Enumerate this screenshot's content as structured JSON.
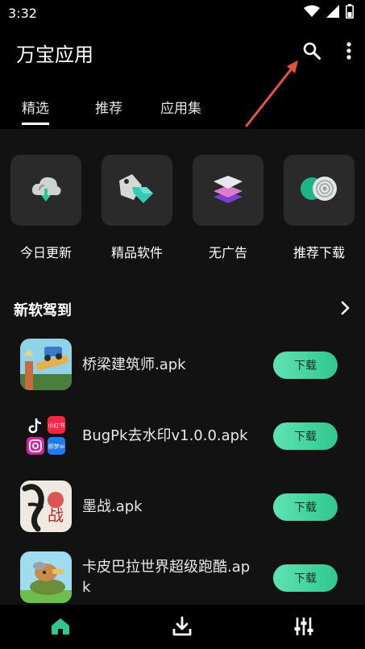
{
  "status_bar": {
    "time": "3:32"
  },
  "app_bar": {
    "title": "万宝应用"
  },
  "tabs": [
    {
      "label": "精选"
    },
    {
      "label": "推荐"
    },
    {
      "label": "应用集"
    }
  ],
  "categories": [
    {
      "label": "今日更新",
      "icon": "cloud-download-icon"
    },
    {
      "label": "精品软件",
      "icon": "gem-tag-icon"
    },
    {
      "label": "无广告",
      "icon": "layers-icon"
    },
    {
      "label": "推荐下载",
      "icon": "target-icon"
    }
  ],
  "section": {
    "title": "新软驾到"
  },
  "apps": [
    {
      "name": "桥梁建筑师.apk",
      "button": "下载"
    },
    {
      "name": "BugPk去水印v1.0.0.apk",
      "button": "下载"
    },
    {
      "name": "墨战.apk",
      "button": "下载"
    },
    {
      "name": "卡皮巴拉世界超级跑酷.apk",
      "button": "下载"
    }
  ],
  "bugpk_icon_labels": {
    "top_right": "小红书",
    "bottom_right": "即梦ai"
  },
  "moz_icon_label": "战",
  "colors": {
    "accent": "#2ec88e",
    "background": "#121212",
    "card": "#2a2a2a",
    "arrow": "#e5553e"
  }
}
